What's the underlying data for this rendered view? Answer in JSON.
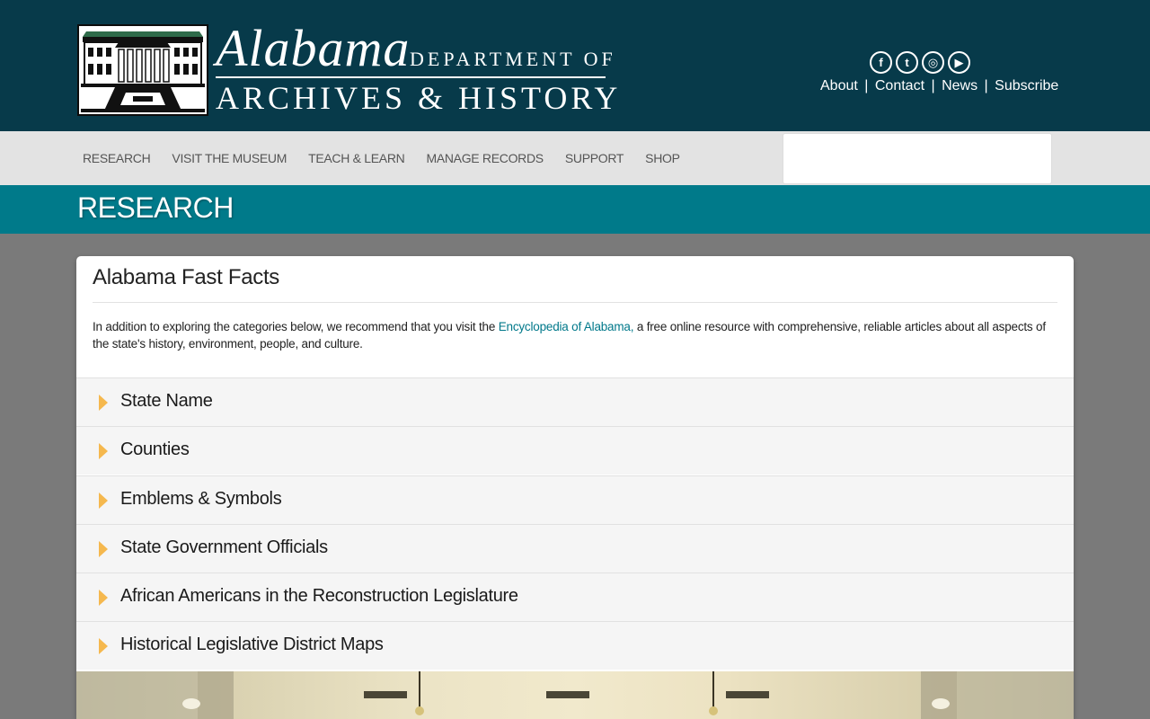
{
  "header": {
    "brand": {
      "alabama": "Alabama",
      "dept_of": "DEPARTMENT OF",
      "archives": "ARCHIVES & HISTORY"
    },
    "social": [
      {
        "name": "facebook-icon",
        "glyph": "f"
      },
      {
        "name": "twitter-icon",
        "glyph": "t"
      },
      {
        "name": "instagram-icon",
        "glyph": "◎"
      },
      {
        "name": "youtube-icon",
        "glyph": "▶"
      }
    ],
    "links": {
      "about": "About",
      "contact": "Contact",
      "news": "News",
      "subscribe": "Subscribe",
      "separator": "|"
    },
    "colors": {
      "background": "#073a4a"
    }
  },
  "nav": {
    "items": [
      {
        "label": "RESEARCH"
      },
      {
        "label": "VISIT THE MUSEUM"
      },
      {
        "label": "TEACH & LEARN"
      },
      {
        "label": "MANAGE RECORDS"
      },
      {
        "label": "SUPPORT"
      },
      {
        "label": "SHOP"
      }
    ],
    "search_placeholder": ""
  },
  "section": {
    "title": "RESEARCH",
    "color": "#007a8a"
  },
  "panel": {
    "title": "Alabama Fast Facts",
    "intro_before": "In addition to exploring the categories below, we recommend that you visit the ",
    "intro_link": "Encyclopedia of Alabama,",
    "intro_after": " a free online resource with comprehensive, reliable articles about all aspects of the state's history, environment, people, and culture.",
    "accordion": [
      {
        "label": "State Name"
      },
      {
        "label": "Counties"
      },
      {
        "label": "Emblems & Symbols"
      },
      {
        "label": "State Government Officials"
      },
      {
        "label": "African Americans in the Reconstruction Legislature"
      },
      {
        "label": "Historical Legislative District Maps"
      }
    ],
    "arrow_color": "#f5b84e"
  }
}
